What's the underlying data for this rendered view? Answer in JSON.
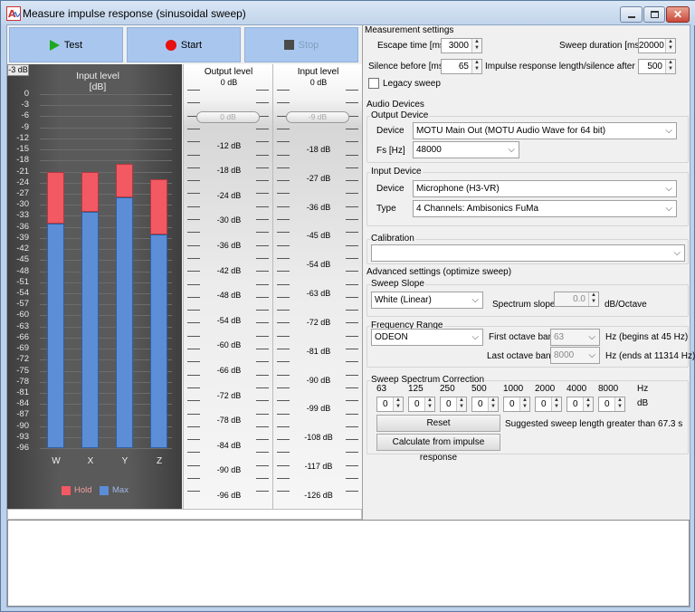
{
  "window": {
    "title": "Measure impulse response (sinusoidal sweep)"
  },
  "toolbar": {
    "test_label": "Test",
    "start_label": "Start",
    "stop_label": "Stop"
  },
  "meter": {
    "badge": "-3 dB",
    "title": "Input level",
    "unit": "[dB]",
    "yticks": [
      "0",
      "-3",
      "-6",
      "-9",
      "-12",
      "-15",
      "-18",
      "-21",
      "-24",
      "-27",
      "-30",
      "-33",
      "-36",
      "-39",
      "-42",
      "-45",
      "-48",
      "-51",
      "-54",
      "-57",
      "-60",
      "-63",
      "-66",
      "-69",
      "-72",
      "-75",
      "-78",
      "-81",
      "-84",
      "-87",
      "-90",
      "-93",
      "-96"
    ],
    "channels": [
      "W",
      "X",
      "Y",
      "Z"
    ],
    "legend_hold": "Hold",
    "legend_max": "Max",
    "hold_db": [
      -21,
      -21,
      -19,
      -23
    ],
    "max_db": [
      -35,
      -32,
      -28,
      -38
    ],
    "colors": {
      "hold": "#f25962",
      "max": "#5b8ed6"
    }
  },
  "output_scale": {
    "title": "Output level",
    "labels": [
      "0 dB",
      "-12 dB",
      "-18 dB",
      "-24 dB",
      "-30 dB",
      "-36 dB",
      "-42 dB",
      "-48 dB",
      "-54 dB",
      "-60 dB",
      "-66 dB",
      "-72 dB",
      "-78 dB",
      "-84 dB",
      "-90 dB",
      "-96 dB"
    ],
    "slider_value": "0 dB"
  },
  "input_scale": {
    "title": "Input level",
    "labels": [
      "0 dB",
      "-18 dB",
      "-27 dB",
      "-36 dB",
      "-45 dB",
      "-54 dB",
      "-63 dB",
      "-72 dB",
      "-81 dB",
      "-90 dB",
      "-99 dB",
      "-108 dB",
      "-117 dB",
      "-126 dB"
    ],
    "slider_value": "-9 dB"
  },
  "measurement": {
    "title": "Measurement settings",
    "escape_label": "Escape time [ms]",
    "escape_value": "3000",
    "sweep_dur_label": "Sweep duration [ms]",
    "sweep_dur_value": "20000",
    "silence_label": "Silence before [ms]",
    "silence_value": "65",
    "ir_len_label": "Impulse response length/silence after [ms]",
    "ir_len_value": "500",
    "legacy_label": "Legacy sweep"
  },
  "audio": {
    "title": "Audio Devices",
    "output_group": "Output Device",
    "device_label": "Device",
    "output_device": "MOTU Main Out (MOTU Audio Wave for 64 bit)",
    "fs_label": "Fs [Hz]",
    "fs_value": "48000",
    "input_group": "Input Device",
    "input_device": "Microphone (H3-VR)",
    "type_label": "Type",
    "type_value": "4 Channels: Ambisonics FuMa"
  },
  "calibration": {
    "title": "Calibration",
    "value": ""
  },
  "advanced": {
    "title": "Advanced settings (optimize sweep)",
    "slope_group": "Sweep Slope",
    "slope_value": "White (Linear)",
    "spectrum_slope_label": "Spectrum slope",
    "spectrum_slope_value": "0.0",
    "spectrum_slope_unit": "dB/Octave",
    "freq_group": "Frequency Range",
    "freq_value": "ODEON",
    "first_band_label": "First octave band",
    "first_band_value": "63",
    "first_band_note": "Hz (begins at 45 Hz)",
    "last_band_label": "Last octave band",
    "last_band_value": "8000",
    "last_band_note": "Hz (ends at 11314 Hz)",
    "correction_group": "Sweep Spectrum Correction",
    "bands": [
      "63",
      "125",
      "250",
      "500",
      "1000",
      "2000",
      "4000",
      "8000"
    ],
    "hz_unit": "Hz",
    "band_values": [
      "0",
      "0",
      "0",
      "0",
      "0",
      "0",
      "0",
      "0"
    ],
    "db_unit": "dB",
    "reset_label": "Reset",
    "suggestion": "Suggested sweep length greater than 67.3 s",
    "calc_label": "Calculate from impulse response"
  }
}
